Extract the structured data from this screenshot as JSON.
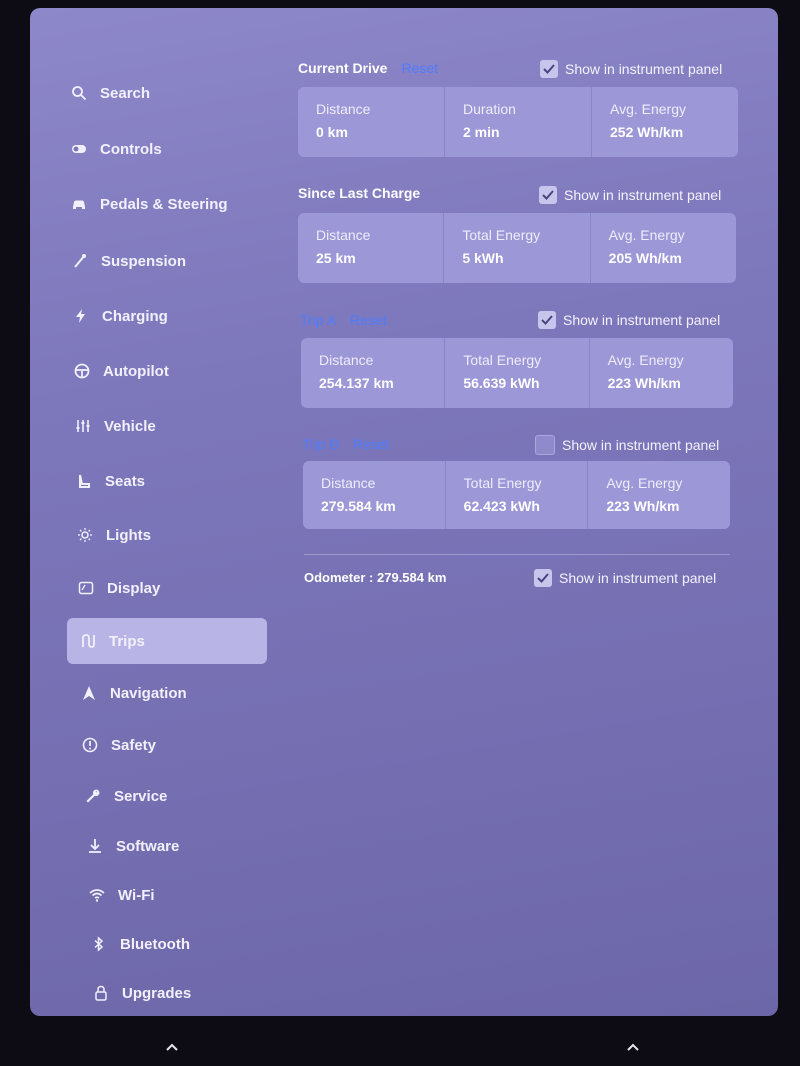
{
  "sidebar": {
    "items": [
      {
        "label": "Search",
        "icon": "search-icon"
      },
      {
        "label": "Controls",
        "icon": "toggle-icon"
      },
      {
        "label": "Pedals & Steering",
        "icon": "car-icon"
      },
      {
        "label": "Suspension",
        "icon": "suspension-icon"
      },
      {
        "label": "Charging",
        "icon": "bolt-icon"
      },
      {
        "label": "Autopilot",
        "icon": "steering-wheel-icon"
      },
      {
        "label": "Vehicle",
        "icon": "sliders-icon"
      },
      {
        "label": "Seats",
        "icon": "seat-icon"
      },
      {
        "label": "Lights",
        "icon": "sun-icon"
      },
      {
        "label": "Display",
        "icon": "display-icon"
      },
      {
        "label": "Trips",
        "icon": "trips-icon",
        "active": true
      },
      {
        "label": "Navigation",
        "icon": "navigation-icon"
      },
      {
        "label": "Safety",
        "icon": "safety-icon"
      },
      {
        "label": "Service",
        "icon": "wrench-icon"
      },
      {
        "label": "Software",
        "icon": "download-icon"
      },
      {
        "label": "Wi-Fi",
        "icon": "wifi-icon"
      },
      {
        "label": "Bluetooth",
        "icon": "bluetooth-icon"
      },
      {
        "label": "Upgrades",
        "icon": "lock-icon"
      }
    ]
  },
  "current_drive": {
    "title": "Current Drive",
    "reset": "Reset",
    "show_label": "Show in instrument panel",
    "show_checked": true,
    "stats": [
      {
        "label": "Distance",
        "value": "0 km"
      },
      {
        "label": "Duration",
        "value": "2 min"
      },
      {
        "label": "Avg. Energy",
        "value": "252 Wh/km"
      }
    ]
  },
  "since_last_charge": {
    "title": "Since Last Charge",
    "show_label": "Show in instrument panel",
    "show_checked": true,
    "stats": [
      {
        "label": "Distance",
        "value": "25 km"
      },
      {
        "label": "Total Energy",
        "value": "5 kWh"
      },
      {
        "label": "Avg. Energy",
        "value": "205 Wh/km"
      }
    ]
  },
  "trip_a": {
    "title": "Trip A",
    "reset": "Reset",
    "show_label": "Show in instrument panel",
    "show_checked": true,
    "stats": [
      {
        "label": "Distance",
        "value": "254.137 km"
      },
      {
        "label": "Total Energy",
        "value": "56.639 kWh"
      },
      {
        "label": "Avg. Energy",
        "value": "223 Wh/km"
      }
    ]
  },
  "trip_b": {
    "title": "Trip B",
    "reset": "Reset",
    "show_label": "Show in instrument panel",
    "show_checked": false,
    "stats": [
      {
        "label": "Distance",
        "value": "279.584 km"
      },
      {
        "label": "Total Energy",
        "value": "62.423 kWh"
      },
      {
        "label": "Avg. Energy",
        "value": "223 Wh/km"
      }
    ]
  },
  "odometer": {
    "label": "Odometer",
    "separator": ":",
    "value": "279.584 km",
    "show_label": "Show in instrument panel",
    "show_checked": true
  },
  "colors": {
    "accent_link": "#4f7cff",
    "active_item": "#b9b4e6",
    "panel_bg": "#9c97d6"
  }
}
